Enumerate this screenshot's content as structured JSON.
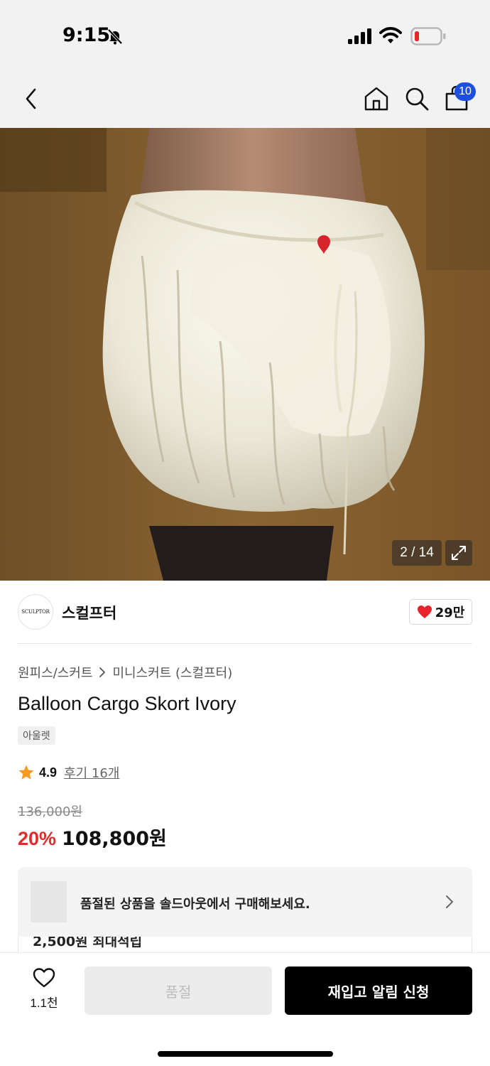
{
  "status_bar": {
    "time": "9:15"
  },
  "nav": {
    "cart_count": "10"
  },
  "gallery": {
    "counter": "2 / 14"
  },
  "brand": {
    "logo_text": "SCULPTOR",
    "name": "스컬프터",
    "like_count": "29만"
  },
  "breadcrumb": {
    "category": "원피스/스커트",
    "subcategory": "미니스커트 (스컬프터)"
  },
  "product": {
    "title": "Balloon Cargo Skort Ivory",
    "tag": "아울렛",
    "rating": "4.9",
    "review_link": "후기 16개",
    "original_price": "136,000원",
    "discount": "20%",
    "sale_price": "108,800원"
  },
  "soldout_banner": {
    "text": "품절된 상품을 솔드아웃에서 구매해보세요."
  },
  "benefit": {
    "text": "2,500원 최대적립"
  },
  "bottom_bar": {
    "wish_count": "1.1천",
    "soldout_label": "품절",
    "restock_label": "재입고 알림 신청"
  },
  "colors": {
    "accent_red": "#e22b2b",
    "badge_blue": "#1f4fe0",
    "heart_red": "#e8232b",
    "star_orange": "#f59a23"
  }
}
